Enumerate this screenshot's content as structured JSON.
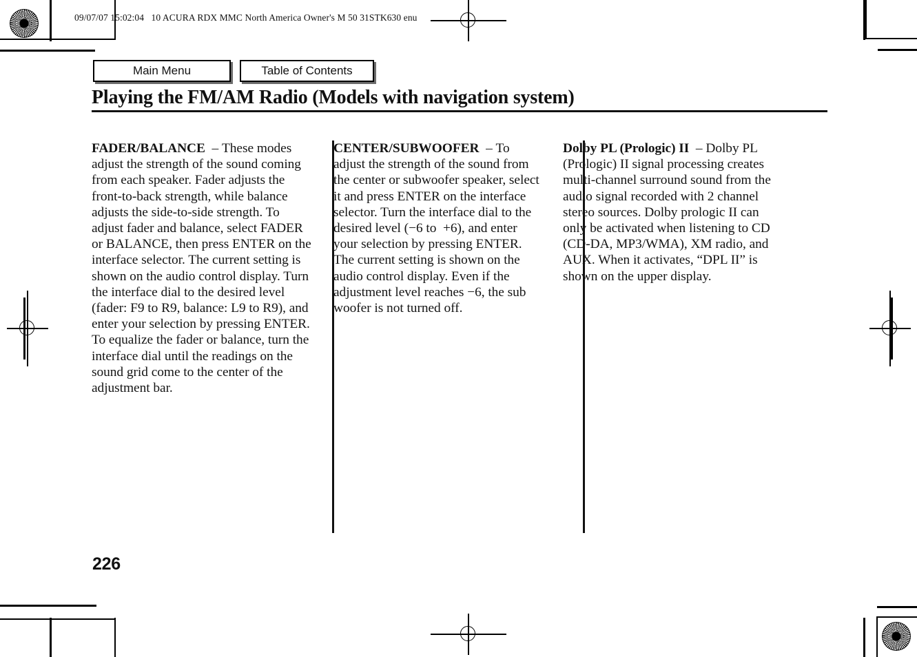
{
  "document": {
    "slug": "09/07/07 15:02:04   10 ACURA RDX MMC North America Owner's M 50 31STK630 enu",
    "title": "Playing the FM/AM Radio (Models with navigation system)",
    "page_number": "226"
  },
  "nav": {
    "main_menu": "Main Menu",
    "table_of_contents": "Table of Contents"
  },
  "columns": [
    {
      "heading": "FADER/BALANCE",
      "separator": "–",
      "body": "These modes adjust the strength of the sound coming from each speaker. Fader adjusts the front-to-back strength, while balance adjusts the side-to-side strength. To adjust fader and balance, select FADER or BALANCE, then press ENTER on the interface selector. The current setting is shown on the audio control display. Turn the interface dial to the desired level (fader: F9 to R9, balance: L9 to R9), and enter your selection by pressing ENTER. To equalize the fader or balance, turn the interface dial until the readings on the sound grid come to the center of the adjustment bar."
    },
    {
      "heading": "CENTER/SUBWOOFER",
      "separator": "–",
      "body": "To adjust the strength of the sound from the center or subwoofer speaker, select it and press ENTER on the interface selector. Turn the interface dial to the desired level (−6 to  +6), and enter your selection by pressing ENTER. The current setting is shown on the audio control display. Even if the adjustment level reaches −6, the sub woofer is not turned off."
    },
    {
      "heading": "Dolby PL (Prologic) II",
      "separator": "–",
      "body": "Dolby PL (Prologic) II signal processing creates multi-channel surround sound from the audio signal recorded with 2 channel stereo sources. Dolby prologic II can only be activated when listening to CD (CD-DA, MP3/WMA), XM radio, and AUX. When it activates, “DPL II” is shown on the upper display."
    }
  ],
  "print_marks": {
    "starburst_top_left": "registration-starburst",
    "starburst_bottom_right": "registration-starburst",
    "crosshair_top_center": "registration-crosshair",
    "crosshair_bottom_center": "registration-crosshair",
    "crosshair_left_middle": "registration-crosshair",
    "crosshair_right_middle": "registration-crosshair"
  }
}
